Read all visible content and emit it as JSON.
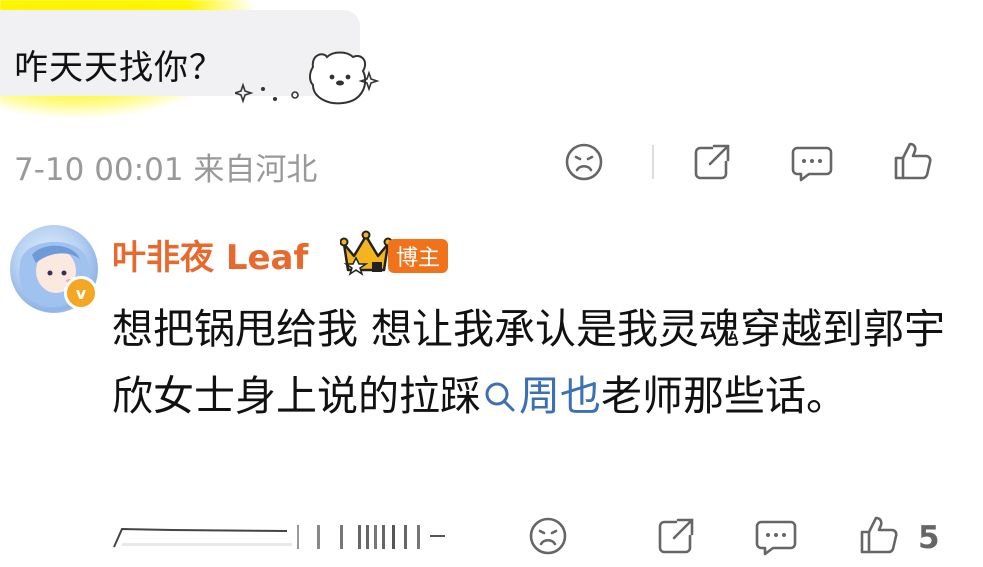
{
  "top_comment": {
    "text": "咋天天找你？",
    "meta": "7-10 00:01 来自河北"
  },
  "reply": {
    "username": "叶非夜 Leaf",
    "owner_badge": "博主",
    "text_before": "想把锅甩给我 想让我承认是我灵魂穿越到郭宇欣女士身上说的拉踩",
    "topic_link": "周也",
    "text_after": "老师那些话。",
    "like_count": "5"
  },
  "colors": {
    "username": "#e8692d",
    "topic": "#3c6fb5",
    "meta": "#999999",
    "badge": "#f0731c"
  },
  "icons": [
    "frown-icon",
    "share-icon",
    "comment-icon",
    "like-icon",
    "search-icon",
    "crown-icon"
  ]
}
